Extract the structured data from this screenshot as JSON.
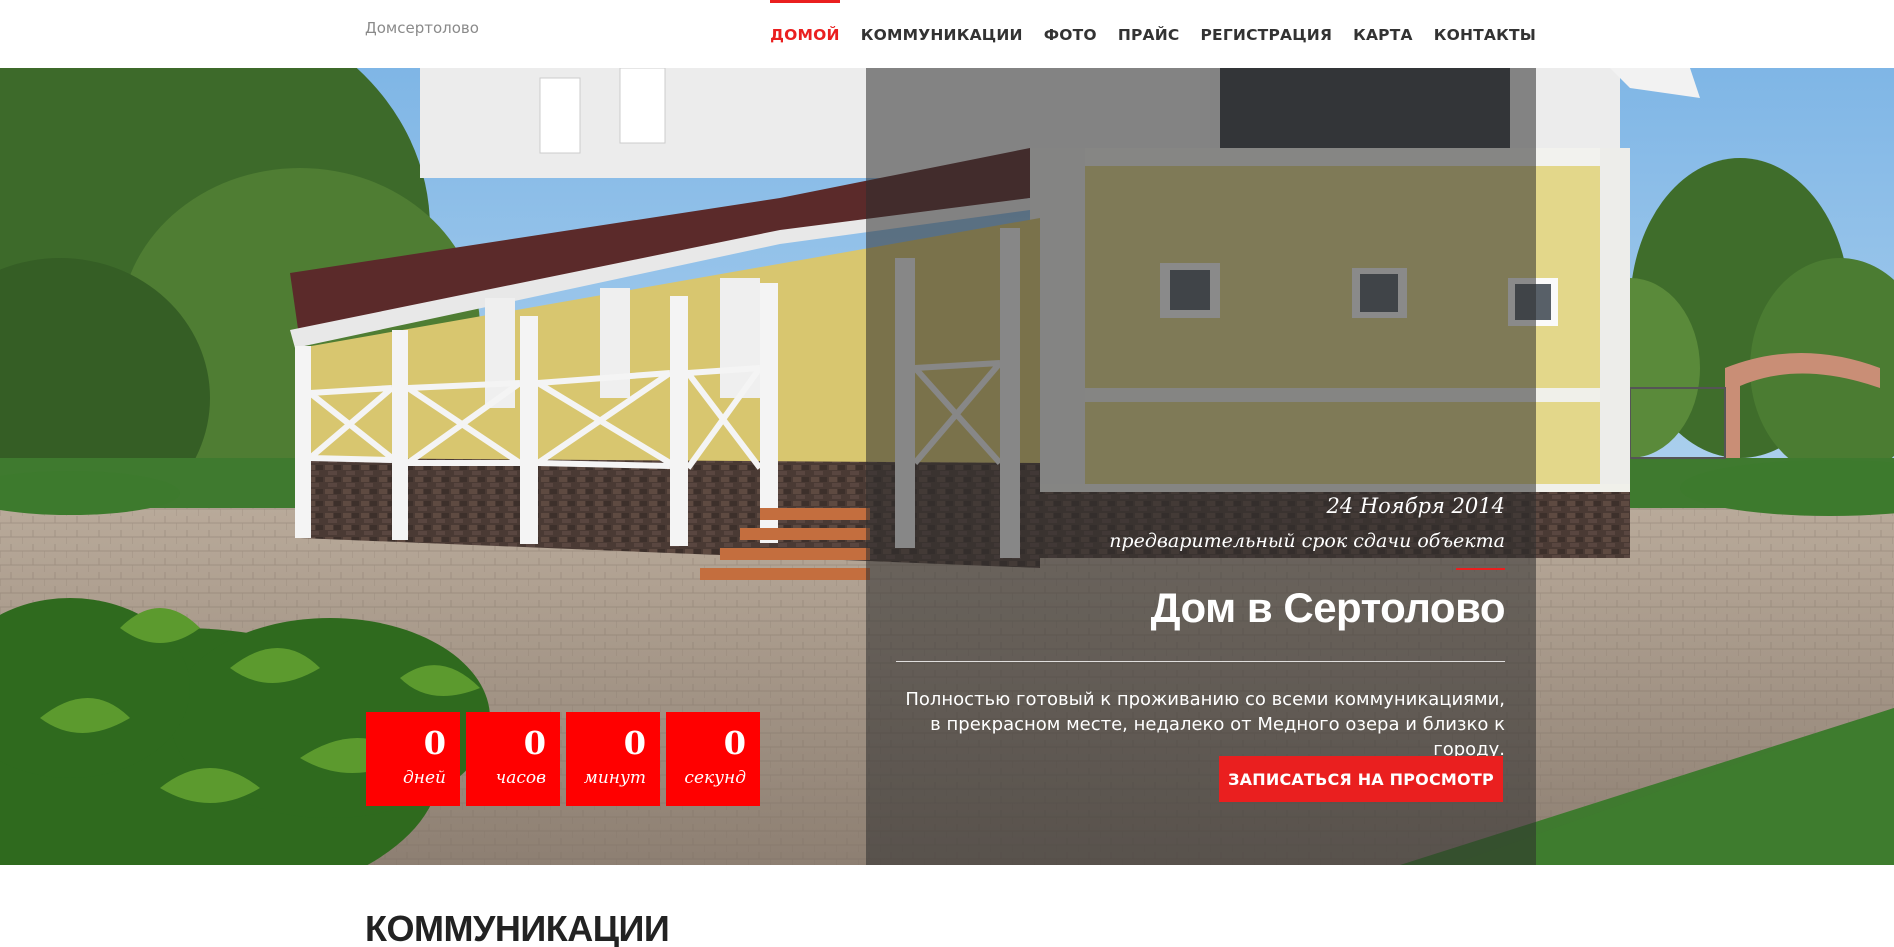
{
  "header": {
    "brand": "Домсертолово",
    "nav": [
      {
        "label": "ДОМОЙ",
        "active": true
      },
      {
        "label": "КОММУНИКАЦИИ",
        "active": false
      },
      {
        "label": "ФОТО",
        "active": false
      },
      {
        "label": "ПРАЙС",
        "active": false
      },
      {
        "label": "РЕГИСТРАЦИЯ",
        "active": false
      },
      {
        "label": "КАРТА",
        "active": false
      },
      {
        "label": "КОНТАКТЫ",
        "active": false
      }
    ]
  },
  "hero": {
    "deadline_date": "24 Ноября 2014",
    "deadline_caption": "предварительный срок сдачи объекта",
    "title": "Дом в Сертолово",
    "description": "Полностью готовый к проживанию со всеми коммуникациями, в прекрасном месте, недалеко от Медного озера и близко к городу.",
    "cta_label": "ЗАПИСАТЬСЯ НА ПРОСМОТР"
  },
  "countdown": [
    {
      "value": "0",
      "label": "дней"
    },
    {
      "value": "0",
      "label": "часов"
    },
    {
      "value": "0",
      "label": "минут"
    },
    {
      "value": "0",
      "label": "секунд"
    }
  ],
  "next_section": {
    "title": "КОММУНИКАЦИИ"
  },
  "colors": {
    "accent": "#ea1f1f",
    "countdown_bg": "#ff0000",
    "overlay": "rgba(45,45,45,0.55)"
  }
}
